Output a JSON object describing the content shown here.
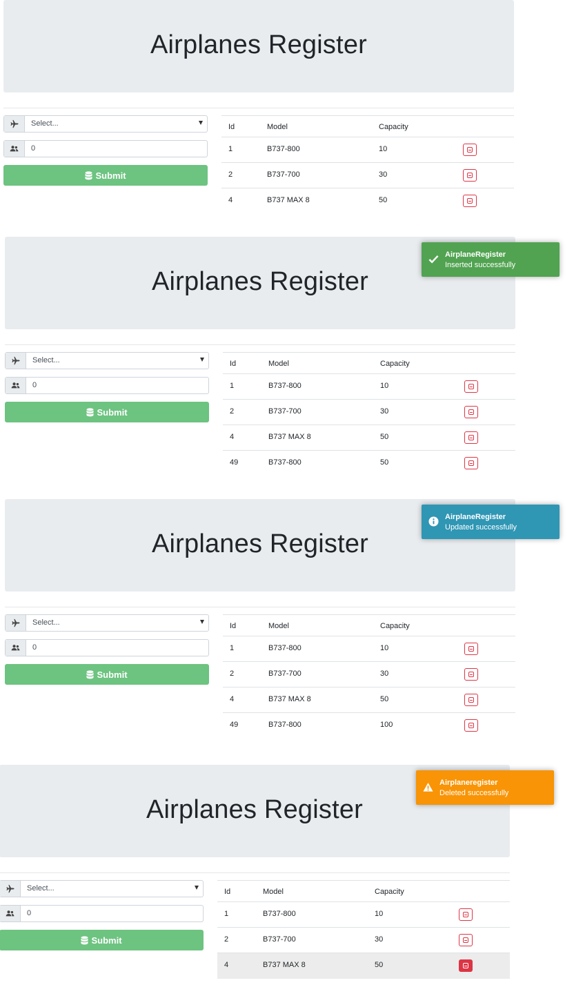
{
  "colors": {
    "success": "#51a351",
    "info": "#2f96b4",
    "warning": "#f89406",
    "submit": "#6dc380",
    "danger": "#dc3545"
  },
  "panels": [
    {
      "title": "Airplanes Register",
      "select_placeholder": "Select...",
      "capacity_value": "0",
      "submit_label": "Submit",
      "headers": {
        "id": "Id",
        "model": "Model",
        "capacity": "Capacity"
      },
      "rows": [
        {
          "id": "1",
          "model": "B737-800",
          "capacity": "10"
        },
        {
          "id": "2",
          "model": "B737-700",
          "capacity": "30"
        },
        {
          "id": "4",
          "model": "B737 MAX 8",
          "capacity": "50"
        }
      ]
    },
    {
      "title": "Airplanes Register",
      "select_placeholder": "Select...",
      "capacity_value": "0",
      "submit_label": "Submit",
      "headers": {
        "id": "Id",
        "model": "Model",
        "capacity": "Capacity"
      },
      "rows": [
        {
          "id": "1",
          "model": "B737-800",
          "capacity": "10"
        },
        {
          "id": "2",
          "model": "B737-700",
          "capacity": "30"
        },
        {
          "id": "4",
          "model": "B737 MAX 8",
          "capacity": "50"
        },
        {
          "id": "49",
          "model": "B737-800",
          "capacity": "50"
        }
      ],
      "toast": {
        "type": "success",
        "icon": "check-icon",
        "title": "AirplaneRegister",
        "message": "Inserted successfully"
      }
    },
    {
      "title": "Airplanes Register",
      "select_placeholder": "Select...",
      "capacity_value": "0",
      "submit_label": "Submit",
      "headers": {
        "id": "Id",
        "model": "Model",
        "capacity": "Capacity"
      },
      "rows": [
        {
          "id": "1",
          "model": "B737-800",
          "capacity": "10"
        },
        {
          "id": "2",
          "model": "B737-700",
          "capacity": "30"
        },
        {
          "id": "4",
          "model": "B737 MAX 8",
          "capacity": "50"
        },
        {
          "id": "49",
          "model": "B737-800",
          "capacity": "100"
        }
      ],
      "toast": {
        "type": "info",
        "icon": "info-icon",
        "title": "AirplaneRegister",
        "message": "Updated successfully"
      }
    },
    {
      "title": "Airplanes Register",
      "select_placeholder": "Select...",
      "capacity_value": "0",
      "submit_label": "Submit",
      "headers": {
        "id": "Id",
        "model": "Model",
        "capacity": "Capacity"
      },
      "rows": [
        {
          "id": "1",
          "model": "B737-800",
          "capacity": "10"
        },
        {
          "id": "2",
          "model": "B737-700",
          "capacity": "30"
        },
        {
          "id": "4",
          "model": "B737 MAX 8",
          "capacity": "50",
          "hovered": true
        }
      ],
      "toast": {
        "type": "warning",
        "icon": "warning-icon",
        "title": "Airplaneregister",
        "message": "Deleted successfully"
      }
    }
  ]
}
